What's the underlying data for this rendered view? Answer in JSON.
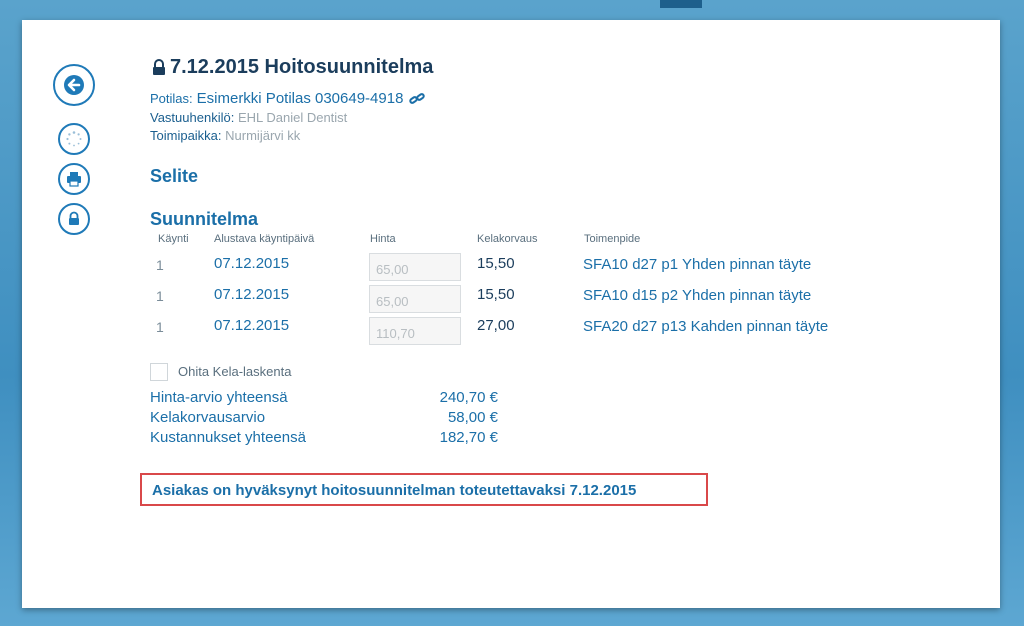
{
  "header": {
    "title": "7.12.2015 Hoitosuunnitelma",
    "patient_label": "Potilas:",
    "patient_value": "Esimerkki Potilas 030649-4918",
    "responsible_label": "Vastuuhenkilö:",
    "responsible_value": "EHL Daniel Dentist",
    "location_label": "Toimipaikka:",
    "location_value": "Nurmijärvi kk"
  },
  "sections": {
    "selite": "Selite",
    "suunnitelma": "Suunnitelma"
  },
  "table": {
    "headers": [
      "Käynti",
      "Alustava käyntipäivä",
      "Hinta",
      "Kelakorvaus",
      "Toimenpide"
    ],
    "rows": [
      {
        "visit": "1",
        "date": "07.12.2015",
        "price": "65,00",
        "kela": "15,50",
        "procedure": "SFA10 d27 p1 Yhden pinnan täyte"
      },
      {
        "visit": "1",
        "date": "07.12.2015",
        "price": "65,00",
        "kela": "15,50",
        "procedure": "SFA10 d15 p2 Yhden pinnan täyte"
      },
      {
        "visit": "1",
        "date": "07.12.2015",
        "price": "110,70",
        "kela": "27,00",
        "procedure": "SFA20 d27 p13 Kahden pinnan täyte"
      }
    ]
  },
  "skip_kela": {
    "label": "Ohita Kela-laskenta",
    "checked": false
  },
  "summary": [
    {
      "label": "Hinta-arvio yhteensä",
      "value": "240,70 €"
    },
    {
      "label": "Kelakorvausarvio",
      "value": "58,00 €"
    },
    {
      "label": "Kustannukset yhteensä",
      "value": "182,70 €"
    }
  ],
  "approval_text": "Asiakas on hyväksynyt hoitosuunnitelman toteutettavaksi 7.12.2015",
  "icons": {
    "back": "back-arrow-icon",
    "sync": "sync-icon",
    "print": "print-icon",
    "lock": "lock-icon",
    "title_lock": "lock-icon",
    "link": "link-icon"
  },
  "colors": {
    "accent": "#1b6fa8",
    "highlight_border": "#d9484a",
    "background": "#4a98c6"
  }
}
